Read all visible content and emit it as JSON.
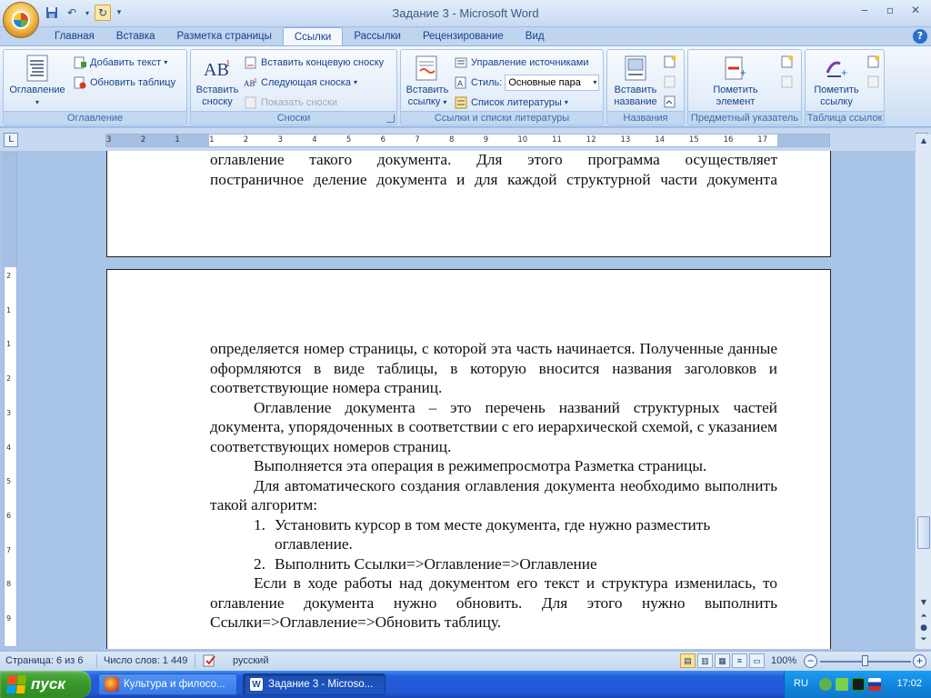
{
  "window": {
    "title": "Задание  3 - Microsoft Word",
    "controls": [
      "‒",
      "▫",
      "✕"
    ]
  },
  "quick_access": {
    "icons": [
      "save-icon",
      "undo-icon",
      "redo-icon"
    ]
  },
  "ribbon": {
    "tabs": [
      "Главная",
      "Вставка",
      "Разметка страницы",
      "Ссылки",
      "Рассылки",
      "Рецензирование",
      "Вид"
    ],
    "active_tab": "Ссылки",
    "groups": {
      "toc": {
        "label": "Оглавление",
        "big_button": "Оглавление",
        "add_text": "Добавить текст",
        "update_table": "Обновить таблицу"
      },
      "footnotes": {
        "label": "Сноски",
        "insert_footnote_line1": "Вставить",
        "insert_footnote_line2": "сноску",
        "insert_endnote": "Вставить концевую сноску",
        "next_footnote": "Следующая сноска",
        "show_notes": "Показать сноски"
      },
      "citations": {
        "label": "Ссылки и списки литературы",
        "insert_citation_line1": "Вставить",
        "insert_citation_line2": "ссылку",
        "manage_sources": "Управление источниками",
        "style_label": "Стиль:",
        "style_value": "Основные пара",
        "bibliography": "Список литературы"
      },
      "captions": {
        "label": "Названия",
        "insert_caption_line1": "Вставить",
        "insert_caption_line2": "название"
      },
      "index": {
        "label": "Предметный указатель",
        "mark_entry_line1": "Пометить",
        "mark_entry_line2": "элемент"
      },
      "toa": {
        "label": "Таблица ссылок",
        "mark_citation_line1": "Пометить",
        "mark_citation_line2": "ссылку"
      }
    }
  },
  "ruler": {
    "h_ticks": [
      "3",
      "2",
      "1",
      "1",
      "2",
      "3",
      "4",
      "5",
      "6",
      "7",
      "8",
      "9",
      "10",
      "11",
      "12",
      "13",
      "14",
      "15",
      "16",
      "17"
    ],
    "v_ticks": [
      "2",
      "1",
      "1",
      "2",
      "3",
      "4",
      "5",
      "6",
      "7",
      "8",
      "9"
    ]
  },
  "document": {
    "page1_lines": [
      "оглавление такого документа. Для этого программа осуществляет",
      "постраничное деление документа и для каждой структурной части документа"
    ],
    "page2_paragraphs": [
      {
        "type": "para",
        "text": "определяется номер страницы, с которой эта часть начинается. Полученные данные оформляются в виде таблицы, в которую вносится названия заголовков и соответствующие номера страниц."
      },
      {
        "type": "indent",
        "text": "Оглавление документа – это перечень названий структурных частей документа, упорядоченных в соответствии с его иерархической схемой, с указанием соответствующих номеров страниц."
      },
      {
        "type": "indent",
        "text": "Выполняется эта операция в режимепросмотра Разметка страницы."
      },
      {
        "type": "indent",
        "text": "Для автоматического создания оглавления документа необходимо выполнить такой алгоритм:"
      },
      {
        "type": "li",
        "num": "1.",
        "text": "Установить курсор в том месте документа, где нужно разместить оглавление."
      },
      {
        "type": "li",
        "num": "2.",
        "text": "Выполнить Ссылки=>Оглавление=>Оглавление"
      },
      {
        "type": "indent",
        "text": "Если в ходе работы над документом его текст и структура изменилась, то оглавление документа нужно обновить. Для этого нужно выполнить Ссылки=>Оглавление=>Обновить таблицу."
      }
    ]
  },
  "statusbar": {
    "page": "Страница: 6 из 6",
    "words": "Число слов: 1 449",
    "language": "русский",
    "zoom": "100%"
  },
  "taskbar": {
    "start": "пуск",
    "items": [
      {
        "label": "Культура и филосо...",
        "active": false
      },
      {
        "label": "Задание  3 - Microso...",
        "active": true
      }
    ],
    "lang": "RU",
    "clock": "17:02"
  }
}
